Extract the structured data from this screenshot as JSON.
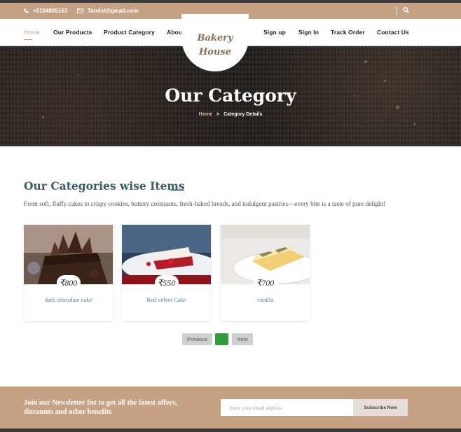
{
  "topbar": {
    "phone": "+5104805163",
    "email": "Tandel@gmail.com",
    "search_icon": "search-icon",
    "phone_icon": "phone-icon",
    "email_icon": "envelope-icon"
  },
  "nav": {
    "left": [
      "Home",
      "Our Products",
      "Product Category",
      "About Us"
    ],
    "right": [
      "Sign up",
      "Sign In",
      "Track Order",
      "Contact Us"
    ],
    "active": "Home"
  },
  "logo": {
    "line1": "Bakery",
    "line2": "House"
  },
  "hero": {
    "title": "Our Category",
    "breadcrumb_home": "Home",
    "breadcrumb_sep": ">",
    "breadcrumb_current": "Category Details"
  },
  "section": {
    "title": "Our Categories wise Items",
    "description": "From soft, fluffy cakes to crispy cookies, buttery croissants, fresh-baked breads, and indulgent pastries—every bite is a taste of pure delight!"
  },
  "products": [
    {
      "name": "dark chocolate cake",
      "price": "₹800"
    },
    {
      "name": "Red velvet Cake",
      "price": "₹550"
    },
    {
      "name": "vanilla",
      "price": "₹700"
    }
  ],
  "pagination": {
    "previous": "Previous",
    "current": "",
    "next": "Next"
  },
  "newsletter": {
    "text": "Join our Newsletter list to get all the latest offers, discounts and other benefits",
    "placeholder": "Enter your email address",
    "button": "Subscribe Now"
  },
  "colors": {
    "brand": "#c6a285",
    "title": "#3b5a6b",
    "link": "#4a7fb0",
    "pager_active": "#2e9e3d"
  }
}
